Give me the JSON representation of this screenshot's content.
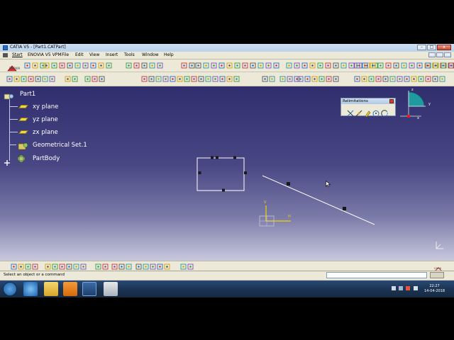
{
  "window": {
    "title": "CATIA V5 - [Part1.CATPart]"
  },
  "menubar": {
    "items": [
      "Start",
      "ENOVIA V5 VPM",
      "File",
      "Edit",
      "View",
      "Insert",
      "Tools",
      "Window",
      "Help"
    ]
  },
  "brand": {
    "enovia_label": "ENOVIA"
  },
  "tree": {
    "root": "Part1",
    "items": [
      "xy plane",
      "yz plane",
      "zx plane",
      "Geometrical Set.1",
      "PartBody"
    ]
  },
  "limit_panel": {
    "title": "Relimitations"
  },
  "compass": {
    "x_label": "x",
    "y_label": "y",
    "z_label": "z"
  },
  "sketch_axes": {
    "h_label": "H",
    "v_label": "V"
  },
  "status": {
    "message": "Select an object or a command"
  },
  "catia_logo": "CATIA",
  "clock": {
    "time": "22:27",
    "date": "14-04-2018"
  },
  "colors": {
    "viewport_top": "#302e6d",
    "viewport_bottom": "#c9c8dd",
    "geometry": "#ffffff",
    "axis_yellow": "#f2d000",
    "compass_accent": "#00aaaa",
    "taskbar": "#1c3454"
  }
}
